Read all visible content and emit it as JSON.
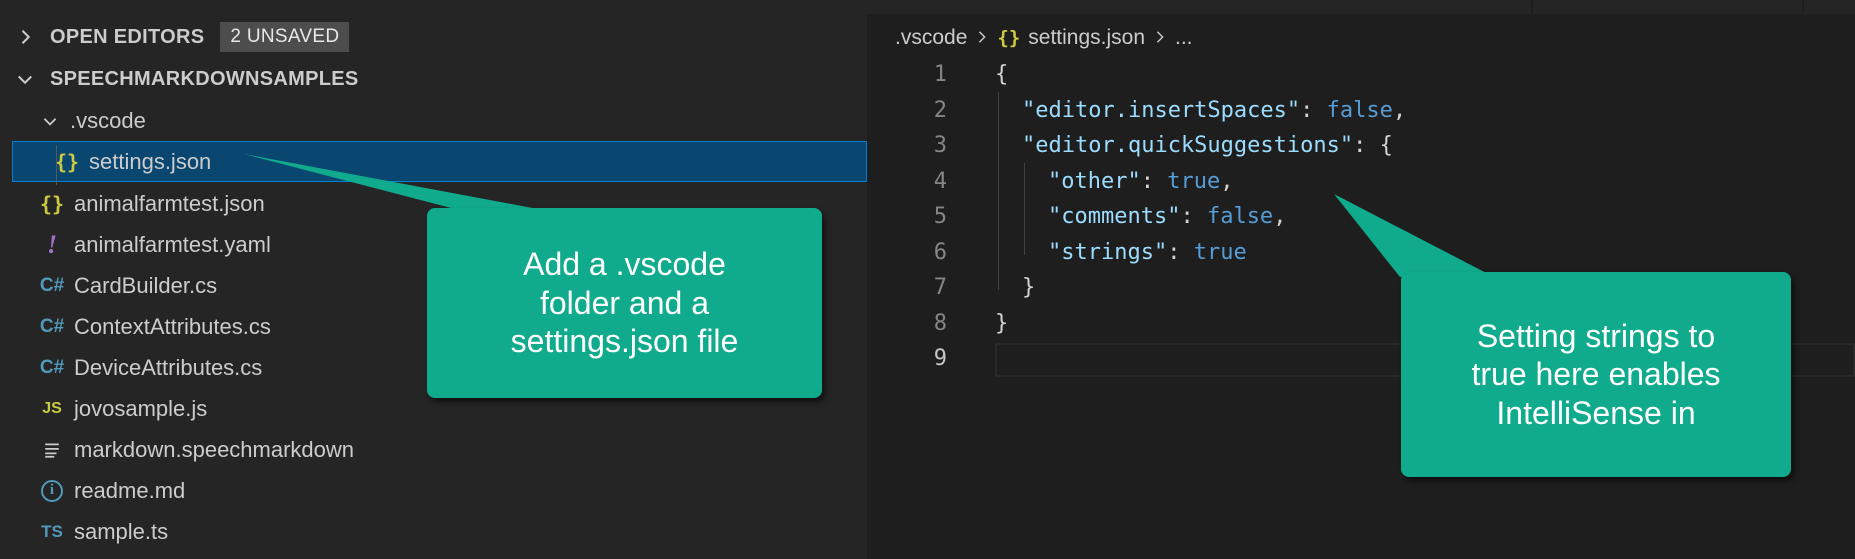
{
  "sidebar": {
    "open_editors": {
      "label": "OPEN EDITORS",
      "badge": "2 UNSAVED"
    },
    "workspace": {
      "label": "SPEECHMARKDOWNSAMPLES"
    },
    "folder": {
      "label": ".vscode"
    },
    "files": [
      {
        "label": "settings.json",
        "icon": "json-icon",
        "selected": true
      },
      {
        "label": "animalfarmtest.json",
        "icon": "json-icon"
      },
      {
        "label": "animalfarmtest.yaml",
        "icon": "yaml-icon"
      },
      {
        "label": "CardBuilder.cs",
        "icon": "csharp-icon"
      },
      {
        "label": "ContextAttributes.cs",
        "icon": "csharp-icon"
      },
      {
        "label": "DeviceAttributes.cs",
        "icon": "csharp-icon"
      },
      {
        "label": "jovosample.js",
        "icon": "javascript-icon"
      },
      {
        "label": "markdown.speechmarkdown",
        "icon": "lines-icon"
      },
      {
        "label": "readme.md",
        "icon": "info-icon"
      },
      {
        "label": "sample.ts",
        "icon": "typescript-icon"
      }
    ],
    "icon_glyphs": {
      "json": "{}",
      "yaml": "!",
      "csharp": "C#",
      "javascript": "JS",
      "typescript": "TS",
      "info": "i"
    }
  },
  "editor": {
    "breadcrumb": {
      "folder": ".vscode",
      "file": "settings.json",
      "more": "..."
    },
    "line_numbers": [
      "1",
      "2",
      "3",
      "4",
      "5",
      "6",
      "7",
      "8",
      "9"
    ],
    "code": {
      "l1_brace": "{",
      "l2_key": "\"editor.insertSpaces\"",
      "l2_colon": ": ",
      "l2_value": "false",
      "l2_comma": ",",
      "l3_key": "\"editor.quickSuggestions\"",
      "l3_rest": ": {",
      "l4_key": "\"other\"",
      "l4_colon": ": ",
      "l4_value": "true",
      "l4_comma": ",",
      "l5_key": "\"comments\"",
      "l5_colon": ": ",
      "l5_value": "false",
      "l5_comma": ",",
      "l6_key": "\"strings\"",
      "l6_colon": ": ",
      "l6_value": "true",
      "l7_brace": "}",
      "l8_brace": "}"
    }
  },
  "callouts": {
    "left": [
      "Add a .vscode",
      "folder and a",
      "settings.json file"
    ],
    "right": [
      "Setting strings to",
      "true here enables",
      "IntelliSense in"
    ]
  },
  "colors": {
    "callout": "#10ab8c",
    "selection": "#094771",
    "keyword": "#569cd6",
    "property": "#9cdcfe"
  }
}
